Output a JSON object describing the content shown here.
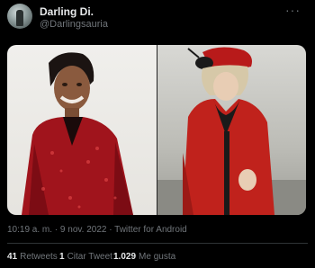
{
  "tweet": {
    "author_name": "Darling Di.",
    "author_handle": "@Darlingsauria",
    "more_icon": "more-horizontal-icon",
    "timestamp": "10:19 a. m. · 9 nov. 2022 · Twitter for Android"
  },
  "stats": [
    {
      "count": "41",
      "label": "Retweets"
    },
    {
      "count": "1",
      "label": "Citar Tweet"
    },
    {
      "count": "1.029",
      "label": "Me gusta"
    }
  ],
  "colors": {
    "background": "#000000",
    "primary_text": "#e7e9ea",
    "secondary_text": "#71767b",
    "divider": "#2f3336"
  }
}
